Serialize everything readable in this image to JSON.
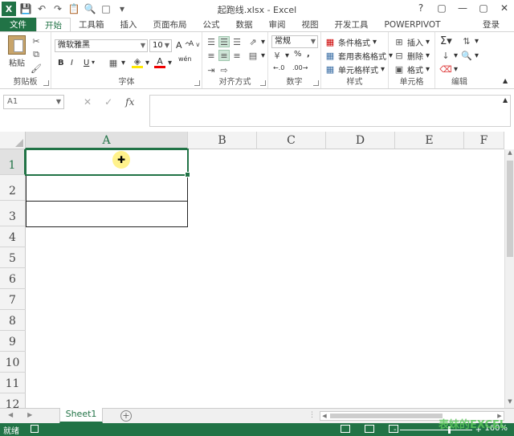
{
  "window": {
    "title": "起跑线.xlsx - Excel",
    "logo": "X",
    "controls": [
      "?",
      "▢",
      "—",
      "▢",
      "✕"
    ]
  },
  "qat": {
    "icons": [
      "save-icon",
      "undo-icon",
      "redo-icon",
      "clipboard-icon",
      "print-preview-icon",
      "new-icon",
      "more-icon"
    ]
  },
  "tabs": {
    "items": [
      "文件",
      "开始",
      "工具箱",
      "插入",
      "页面布局",
      "公式",
      "数据",
      "审阅",
      "视图",
      "开发工具",
      "POWERPIVOT"
    ],
    "active": "开始",
    "signin": "登录"
  },
  "ribbon": {
    "clipboard": {
      "label": "剪贴板",
      "paste": "粘贴"
    },
    "font": {
      "label": "字体",
      "name": "微软雅黑",
      "size": "10",
      "bold": "B",
      "italic": "I",
      "underline": "U",
      "grow": "A",
      "shrink": "A",
      "wen": "wén"
    },
    "alignment": {
      "label": "对齐方式"
    },
    "number": {
      "label": "数字",
      "format": "常规",
      "percent": "%",
      "comma": ","
    },
    "styles": {
      "label": "样式",
      "conditional": "条件格式",
      "table": "套用表格格式",
      "cell": "单元格样式"
    },
    "cells": {
      "label": "单元格",
      "insert": "插入",
      "delete": "删除",
      "format": "格式"
    },
    "editing": {
      "label": "编辑"
    }
  },
  "formula_bar": {
    "namebox": "A1",
    "fx": "fx",
    "cancel": "✕",
    "enter": "✓",
    "value": ""
  },
  "sheet": {
    "columns": [
      "A",
      "B",
      "C",
      "D",
      "E",
      "F"
    ],
    "rows": [
      "1",
      "2",
      "3",
      "4",
      "5",
      "6",
      "7",
      "8",
      "9",
      "10",
      "11",
      "12"
    ],
    "selected_column": "A",
    "selected_row": "1",
    "active_cell": "A1"
  },
  "sheet_tabs": {
    "tabs": [
      "Sheet1"
    ],
    "active": "Sheet1",
    "add": "+"
  },
  "status": {
    "ready": "就绪",
    "zoom": "160%",
    "zoom_minus": "-",
    "zoom_plus": "+"
  },
  "watermark": "表妹的EXCEL"
}
